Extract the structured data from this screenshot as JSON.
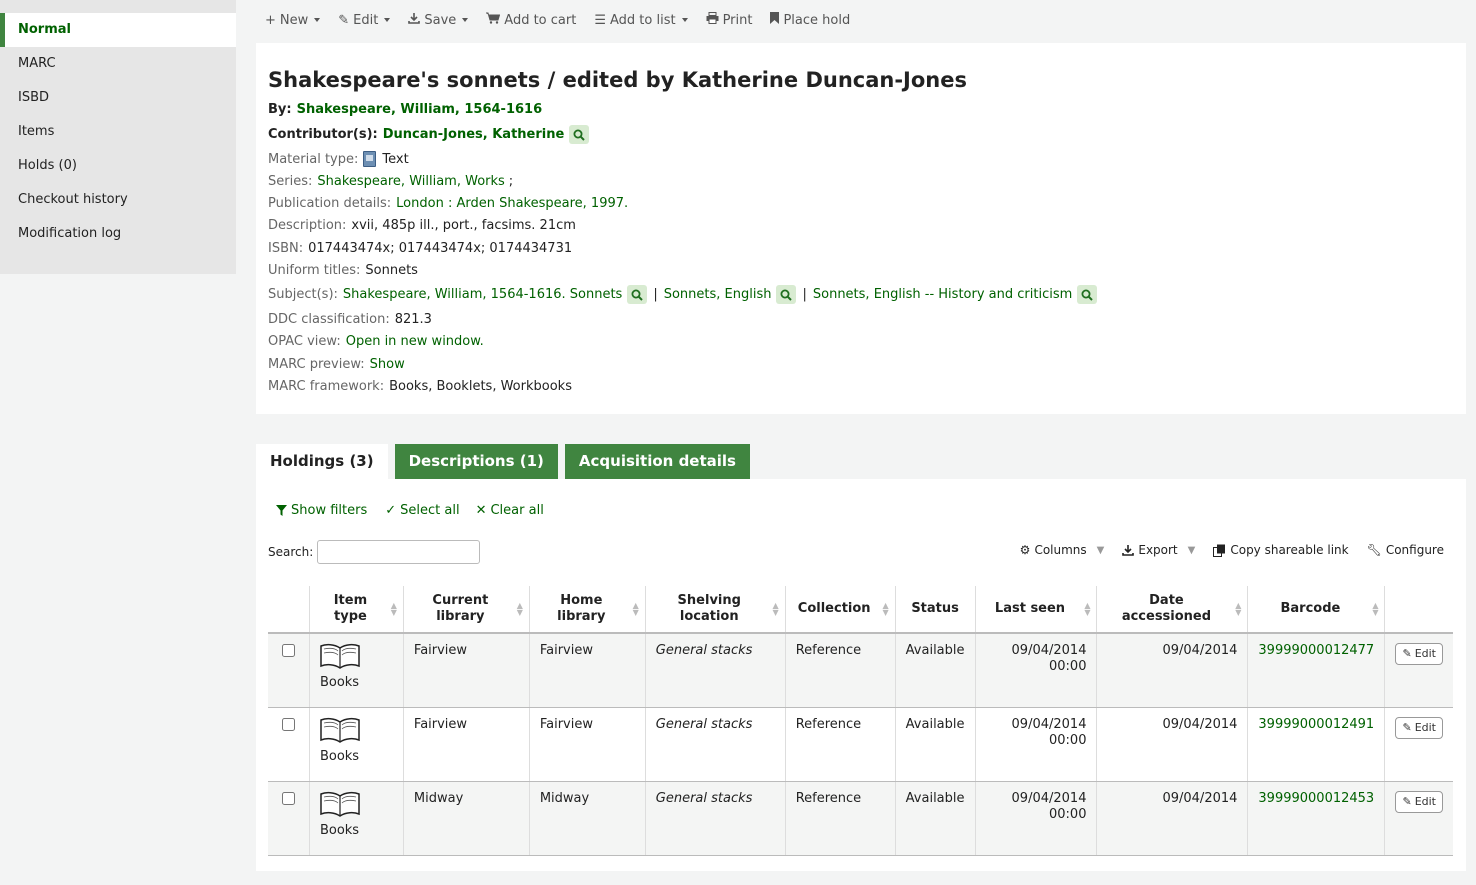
{
  "sidebar": {
    "items": [
      {
        "label": "Normal",
        "active": true
      },
      {
        "label": "MARC"
      },
      {
        "label": "ISBD"
      },
      {
        "label": "Items"
      },
      {
        "label": "Holds (0)"
      },
      {
        "label": "Checkout history"
      },
      {
        "label": "Modification log"
      }
    ]
  },
  "toolbar": {
    "new": "New",
    "edit": "Edit",
    "save": "Save",
    "add_to_cart": "Add to cart",
    "add_to_list": "Add to list",
    "print": "Print",
    "place_hold": "Place hold"
  },
  "record": {
    "title": "Shakespeare's sonnets / edited by Katherine Duncan-Jones",
    "by_label": "By:",
    "author": "Shakespeare, William, 1564-1616",
    "contributors_label": "Contributor(s):",
    "contributor": "Duncan-Jones, Katherine",
    "material_type_label": "Material type:",
    "material_type": "Text",
    "series_label": "Series:",
    "series": "Shakespeare, William, Works",
    "series_suffix": ";",
    "publication_label": "Publication details:",
    "publication": "London : Arden Shakespeare, 1997.",
    "description_label": "Description:",
    "description": "xvii, 485p ill., port., facsims. 21cm",
    "isbn_label": "ISBN:",
    "isbn": "017443474x; 017443474x; 0174434731",
    "uniform_label": "Uniform titles:",
    "uniform": "Sonnets",
    "subjects_label": "Subject(s):",
    "subjects": [
      "Shakespeare, William, 1564-1616. Sonnets",
      "Sonnets, English",
      "Sonnets, English -- History and criticism"
    ],
    "subject_sep": "|",
    "ddc_label": "DDC classification:",
    "ddc": "821.3",
    "opac_label": "OPAC view:",
    "opac": "Open in new window.",
    "marc_preview_label": "MARC preview:",
    "marc_preview": "Show",
    "framework_label": "MARC framework:",
    "framework": "Books, Booklets, Workbooks"
  },
  "tabs": [
    {
      "label": "Holdings (3)",
      "active": true
    },
    {
      "label": "Descriptions (1)"
    },
    {
      "label": "Acquisition details"
    }
  ],
  "holdings": {
    "show_filters": "Show filters",
    "select_all": "Select all",
    "clear_all": "Clear all",
    "search_label": "Search:",
    "search_value": "",
    "columns": "Columns",
    "export": "Export",
    "copy_link": "Copy shareable link",
    "configure": "Configure",
    "headers": [
      "Item type",
      "Current library",
      "Home library",
      "Shelving location",
      "Collection",
      "Status",
      "Last seen",
      "Date accessioned",
      "Barcode"
    ],
    "edit_label": "Edit",
    "rows": [
      {
        "item_type": "Books",
        "current": "Fairview",
        "home": "Fairview",
        "location": "General stacks",
        "collection": "Reference",
        "status": "Available",
        "last_seen": "09/04/2014 00:00",
        "accessioned": "09/04/2014",
        "barcode": "39999000012477"
      },
      {
        "item_type": "Books",
        "current": "Fairview",
        "home": "Fairview",
        "location": "General stacks",
        "collection": "Reference",
        "status": "Available",
        "last_seen": "09/04/2014 00:00",
        "accessioned": "09/04/2014",
        "barcode": "39999000012491"
      },
      {
        "item_type": "Books",
        "current": "Midway",
        "home": "Midway",
        "location": "General stacks",
        "collection": "Reference",
        "status": "Available",
        "last_seen": "09/04/2014 00:00",
        "accessioned": "09/04/2014",
        "barcode": "39999000012453"
      }
    ]
  },
  "colors": {
    "accent": "#408540",
    "link": "#006100"
  }
}
